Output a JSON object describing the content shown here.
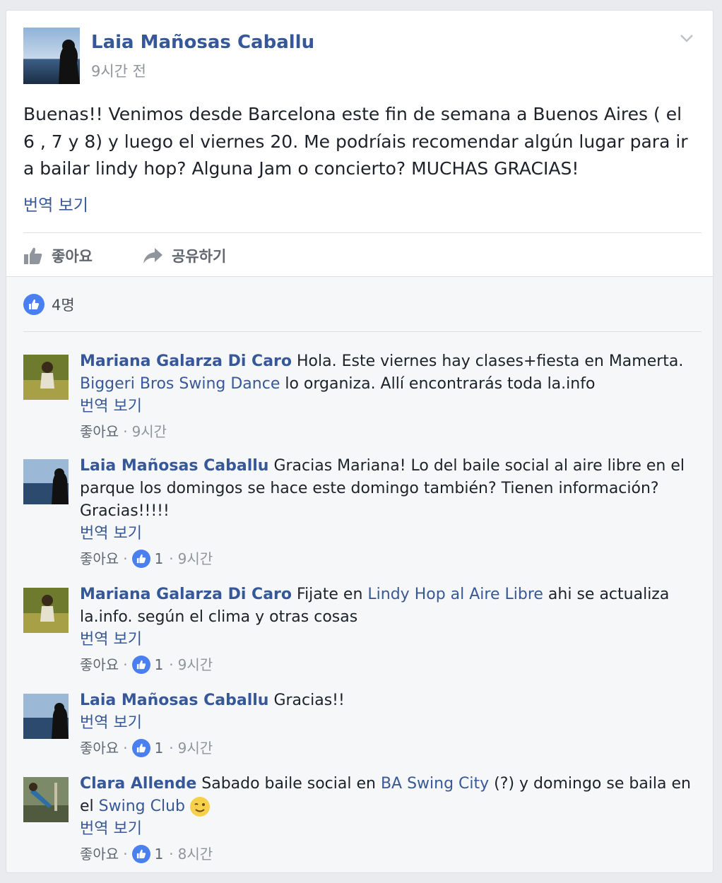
{
  "post": {
    "author": "Laia Mañosas Caballu",
    "timestamp": "9시간 전",
    "text": "Buenas!! Venimos desde Barcelona este fin de semana a Buenos Aires ( el 6 , 7 y 8) y luego el viernes 20. Me podríais recomendar algún lugar para ir a bailar lindy hop? Alguna Jam o concierto? MUCHAS GRACIAS!",
    "see_translation": "번역 보기",
    "actions": {
      "like": "좋아요",
      "share": "공유하기"
    },
    "reactions_count": "4명"
  },
  "comments": [
    {
      "author": "Mariana Galarza Di Caro",
      "text_1": " Hola. Este viernes hay clases+fiesta en Mamerta. ",
      "link_1": "Biggeri Bros Swing Dance",
      "text_2": " lo organiza. Allí encontrarás toda la.info",
      "see_translation": "번역 보기",
      "like_label": "좋아요",
      "sep": "·",
      "time": "9시간"
    },
    {
      "author": "Laia Mañosas Caballu",
      "text_1": " Gracias Mariana! Lo del baile social al aire libre en el parque los domingos se hace este domingo también? Tienen información? Gracias!!!!!",
      "see_translation": "번역 보기",
      "like_label": "좋아요",
      "sep": "·",
      "likes": "1",
      "time": "9시간"
    },
    {
      "author": "Mariana Galarza Di Caro",
      "text_1": " Fijate en ",
      "link_1": "Lindy Hop al Aire Libre",
      "text_2": " ahi se actualiza la.info. según el clima y otras cosas",
      "see_translation": "번역 보기",
      "like_label": "좋아요",
      "sep": "·",
      "likes": "1",
      "time": "9시간"
    },
    {
      "author": "Laia Mañosas Caballu",
      "text_1": " Gracias!!",
      "see_translation": "번역 보기",
      "like_label": "좋아요",
      "sep": "·",
      "likes": "1",
      "time": "9시간"
    },
    {
      "author": "Clara Allende",
      "text_1": " Sabado baile social en ",
      "link_1": "BA Swing City",
      "text_2": " (?) y domingo se baila en el ",
      "link_2": "Swing Club",
      "see_translation": "번역 보기",
      "like_label": "좋아요",
      "sep": "·",
      "likes": "1",
      "time": "8시간"
    }
  ],
  "icons": {
    "post_avatar": "profile-photo-sea-silhouette",
    "chevron": "chevron-down-icon",
    "like": "thumbs-up-icon",
    "share": "share-arrow-icon",
    "emoji": "wink-emoji-icon"
  },
  "colors": {
    "link": "#365899",
    "like_blue": "#4a7ff0",
    "background": "#e9ebee"
  }
}
